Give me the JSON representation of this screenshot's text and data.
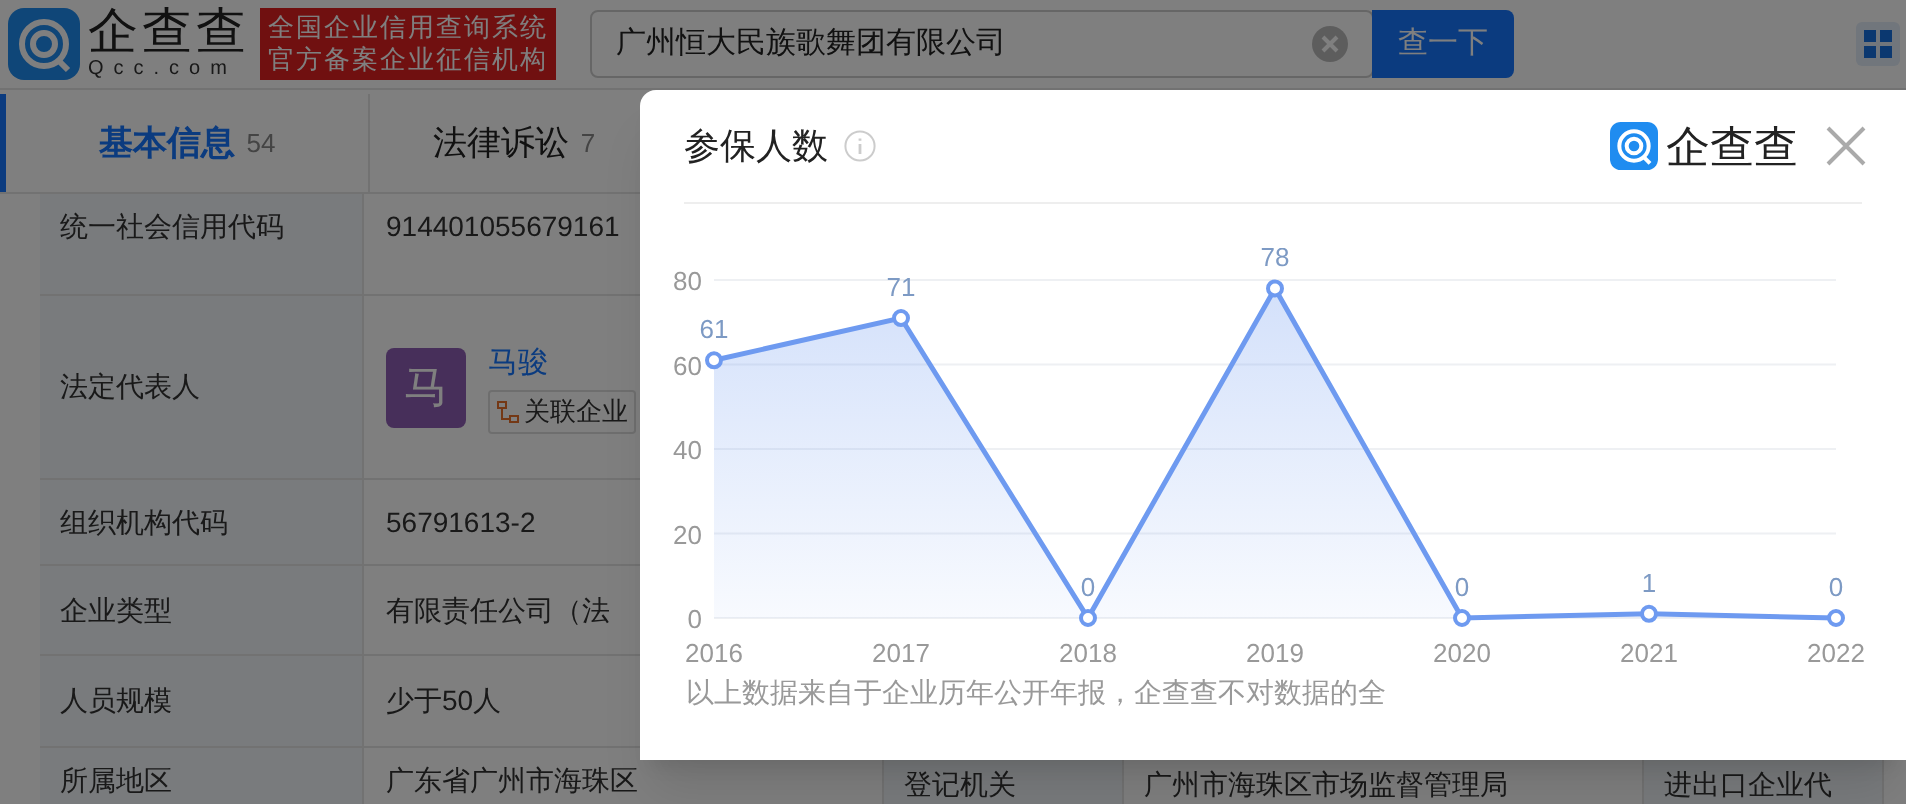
{
  "header": {
    "logo_text": "企查查",
    "logo_subtext": "Qcc.com",
    "badge_lines": [
      "全国企业信用查询系统",
      "官方备案企业征信机构"
    ],
    "search": {
      "value": "广州恒大民族歌舞团有限公司"
    },
    "search_button": "查一下"
  },
  "tabs": [
    {
      "label": "基本信息",
      "count": "54",
      "selected": true
    },
    {
      "label": "法律诉讼",
      "count": "7",
      "selected": false
    }
  ],
  "rows": [
    {
      "kind": "text",
      "label": "统一社会信用代码",
      "value": "914401055679161"
    },
    {
      "kind": "person",
      "label": "法定代表人",
      "avatar": "马",
      "name": "马骏",
      "tag": "关联企业"
    },
    {
      "kind": "text",
      "label": "组织机构代码",
      "value": "56791613-2"
    },
    {
      "kind": "text",
      "label": "企业类型",
      "value": "有限责任公司（法"
    },
    {
      "kind": "text",
      "label": "人员规模",
      "value": "少于50人"
    },
    {
      "kind": "text",
      "label": "所属地区",
      "value": "广东省广州市海珠区",
      "extra": [
        "登记机关",
        "广州市海珠区市场监督管理局",
        "进出口企业代"
      ]
    }
  ],
  "modal": {
    "brand": "企查查",
    "note": "以上数据来自于企业历年公开年报，企查查不对数据的全",
    "chart_data": {
      "type": "area",
      "title": "参保人数",
      "grid": true,
      "categories": [
        "2016",
        "2017",
        "2018",
        "2019",
        "2020",
        "2021",
        "2022"
      ],
      "series": [
        {
          "color": "#6e9af0",
          "values": [
            61,
            71,
            0,
            78,
            0,
            1,
            0
          ]
        }
      ],
      "ylim": [
        0,
        80
      ],
      "yticks": [
        0,
        20,
        40,
        60,
        80
      ],
      "data_labels": true
    }
  }
}
